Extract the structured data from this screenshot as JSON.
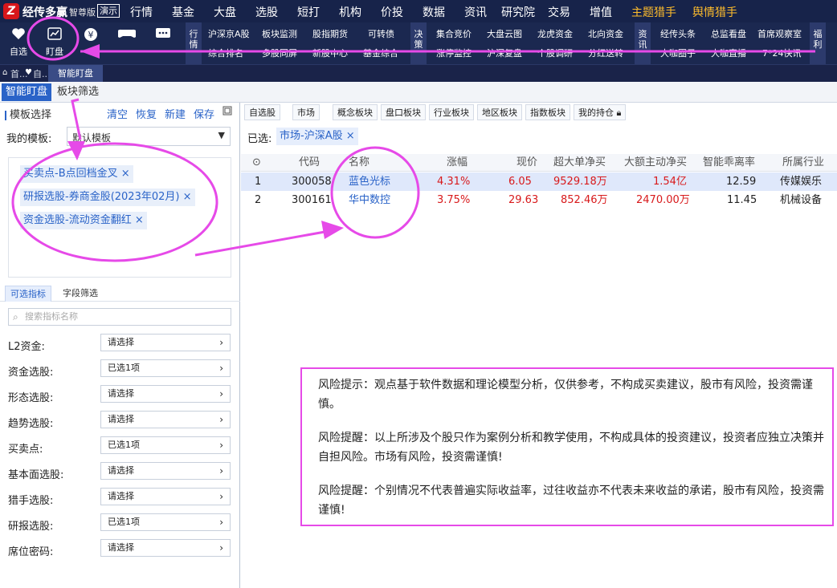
{
  "app": {
    "brand": "经传多赢",
    "edition": "智尊版",
    "demo": "演示"
  },
  "menu": [
    "行情",
    "基金",
    "大盘",
    "选股",
    "短打",
    "机构",
    "价投",
    "数据",
    "资讯",
    "研究院",
    "交易",
    "增值",
    "主题猎手",
    "舆情猎手"
  ],
  "toolbar": {
    "self_label": "自选",
    "watch_label": "盯盘",
    "g1_label": "行情",
    "g1_row1": [
      "沪深京A股",
      "板块监测",
      "股指期货",
      "可转债"
    ],
    "g1_row2": [
      "综合排名",
      "多股同屏",
      "新股中心",
      "基金综合"
    ],
    "g2_label": "决策",
    "g2_row1": [
      "集合竞价",
      "大盘云图",
      "龙虎资金",
      "北向资金"
    ],
    "g2_row2": [
      "涨停监控",
      "沪深复盘",
      "个股调研",
      "分红送转"
    ],
    "g3_label": "资讯",
    "g3_row1": [
      "经传头条",
      "总监看盘",
      "首席观察室"
    ],
    "g3_row2": [
      "大咖圈子",
      "大咖直播",
      "7*24快讯"
    ],
    "g4_label": "福利"
  },
  "tabsrow": {
    "items": [
      "首...",
      "自..."
    ],
    "active": "智能盯盘"
  },
  "subtabs": {
    "active": "智能盯盘",
    "other": "板块筛选"
  },
  "left": {
    "title": "模板选择",
    "actions": [
      "清空",
      "恢复",
      "新建",
      "保存"
    ],
    "my_template_label": "我的模板:",
    "template_value": "默认模板",
    "tags": [
      "买卖点-B点回档金叉",
      "研报选股-券商金股(2023年02月)",
      "资金选股-流动资金翻红"
    ],
    "filter_tabs": [
      "可选指标",
      "字段筛选"
    ],
    "search_placeholder": "搜索指标名称",
    "filters": [
      {
        "label": "L2资金:",
        "value": "请选择"
      },
      {
        "label": "资金选股:",
        "value": "已选1项"
      },
      {
        "label": "形态选股:",
        "value": "请选择"
      },
      {
        "label": "趋势选股:",
        "value": "请选择"
      },
      {
        "label": "买卖点:",
        "value": "已选1项"
      },
      {
        "label": "基本面选股:",
        "value": "请选择"
      },
      {
        "label": "猎手选股:",
        "value": "请选择"
      },
      {
        "label": "研报选股:",
        "value": "已选1项"
      },
      {
        "label": "席位密码:",
        "value": "请选择"
      }
    ]
  },
  "main": {
    "cat_tabs": [
      "自选股",
      "市场",
      "概念板块",
      "盘口板块",
      "行业板块",
      "地区板块",
      "指数板块",
      "我的持仓"
    ],
    "selected_label": "已选:",
    "selected_tag": "市场-沪深A股",
    "columns": [
      "代码",
      "名称",
      "涨幅",
      "现价",
      "超大单净买",
      "大额主动净买",
      "智能乖离率",
      "所属行业"
    ],
    "rows": [
      {
        "idx": "1",
        "code": "300058",
        "name": "蓝色光标",
        "chg": "4.31%",
        "price": "6.05",
        "big": "9529.18万",
        "active": "1.54亿",
        "bias": "12.59",
        "ind": "传媒娱乐"
      },
      {
        "idx": "2",
        "code": "300161",
        "name": "华中数控",
        "chg": "3.75%",
        "price": "29.63",
        "big": "852.46万",
        "active": "2470.00万",
        "bias": "11.45",
        "ind": "机械设备"
      }
    ]
  },
  "notice": [
    "风险提示：观点基于软件数据和理论模型分析，仅供参考，不构成买卖建议，股市有风险，投资需谨慎。",
    "风险提醒：以上所涉及个股只作为案例分析和教学使用，不构成具体的投资建议，投资者应独立决策并自担风险。市场有风险，投资需谨慎!",
    "风险提醒：个别情况不代表普遍实际收益率，过往收益亦不代表未来收益的承诺，股市有风险，投资需谨慎!"
  ],
  "colors": {
    "accent": "#2a63c8",
    "annotation": "#e64ae8",
    "up": "#d8191b",
    "nav": "#17234a"
  },
  "icons": [
    "heart-icon",
    "chart-icon",
    "yuan-icon",
    "gamepad-icon",
    "chat-icon",
    "home-icon",
    "heart-small-icon",
    "search-icon",
    "lock-icon",
    "chevron-down-icon",
    "chevron-right-icon",
    "settings-icon"
  ]
}
